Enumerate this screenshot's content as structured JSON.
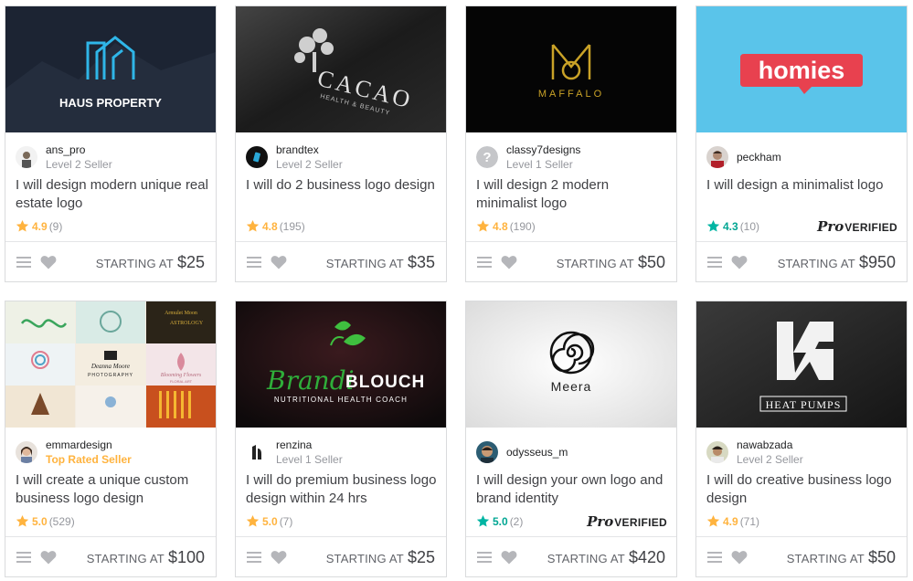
{
  "colors": {
    "star": "#ffb33e",
    "star_pro": "#00b5a3",
    "top_rated": "#ffb33e",
    "muted": "#95979d"
  },
  "icons": {
    "menu": "menu-icon",
    "favorite": "heart-icon",
    "rating": "star-icon"
  },
  "gigs": [
    {
      "thumbnail_text": "HAUS PROPERTY",
      "seller": {
        "name": "ans_pro",
        "level": "Level 2 Seller"
      },
      "title": "I will design modern unique real estate logo",
      "rating": {
        "score": "4.9",
        "count": "(9)"
      },
      "price_label": "STARTING AT",
      "price": "$25"
    },
    {
      "thumbnail_text": "CACAO",
      "thumbnail_subtext": "HEALTH & BEAUTY",
      "seller": {
        "name": "brandtex",
        "level": "Level 2 Seller"
      },
      "title": "I will do 2 business logo design",
      "rating": {
        "score": "4.8",
        "count": "(195)"
      },
      "price_label": "STARTING AT",
      "price": "$35"
    },
    {
      "thumbnail_text": "MAFFALO",
      "seller": {
        "name": "classy7designs",
        "level": "Level 1 Seller"
      },
      "title": "I will design 2 modern minimalist logo",
      "rating": {
        "score": "4.8",
        "count": "(190)"
      },
      "price_label": "STARTING AT",
      "price": "$50"
    },
    {
      "thumbnail_text": "homies",
      "seller": {
        "name": "peckham"
      },
      "title": "I will design a minimalist logo",
      "rating": {
        "score": "4.3",
        "count": "(10)"
      },
      "badge": {
        "logo": "Pro",
        "label": "VERIFIED"
      },
      "price_label": "STARTING AT",
      "price": "$950"
    },
    {
      "thumbnail_labels": [
        "Armulet Moon",
        "ASTROLOGY",
        "Deanna Moore",
        "PHOTOGRAPHY",
        "Blooming Flowers",
        "FLORAL ART"
      ],
      "seller": {
        "name": "emmardesign",
        "level": "Top Rated Seller"
      },
      "title": "I will create a unique custom business logo design",
      "rating": {
        "score": "5.0",
        "count": "(529)"
      },
      "price_label": "STARTING AT",
      "price": "$100"
    },
    {
      "thumbnail_text": "Brandi",
      "thumbnail_text2": "BLOUCH",
      "thumbnail_subtext": "NUTRITIONAL HEALTH COACH",
      "seller": {
        "name": "renzina",
        "level": "Level 1 Seller"
      },
      "title": "I will do premium business logo design within 24 hrs",
      "rating": {
        "score": "5.0",
        "count": "(7)"
      },
      "price_label": "STARTING AT",
      "price": "$25"
    },
    {
      "thumbnail_text": "Meera",
      "seller": {
        "name": "odysseus_m"
      },
      "title": "I will design your own logo and brand identity",
      "rating": {
        "score": "5.0",
        "count": "(2)"
      },
      "badge": {
        "logo": "Pro",
        "label": "VERIFIED"
      },
      "price_label": "STARTING AT",
      "price": "$420"
    },
    {
      "thumbnail_text": "HEAT PUMPS",
      "seller": {
        "name": "nawabzada",
        "level": "Level 2 Seller"
      },
      "title": "I will do creative business logo design",
      "rating": {
        "score": "4.9",
        "count": "(71)"
      },
      "price_label": "STARTING AT",
      "price": "$50"
    }
  ]
}
